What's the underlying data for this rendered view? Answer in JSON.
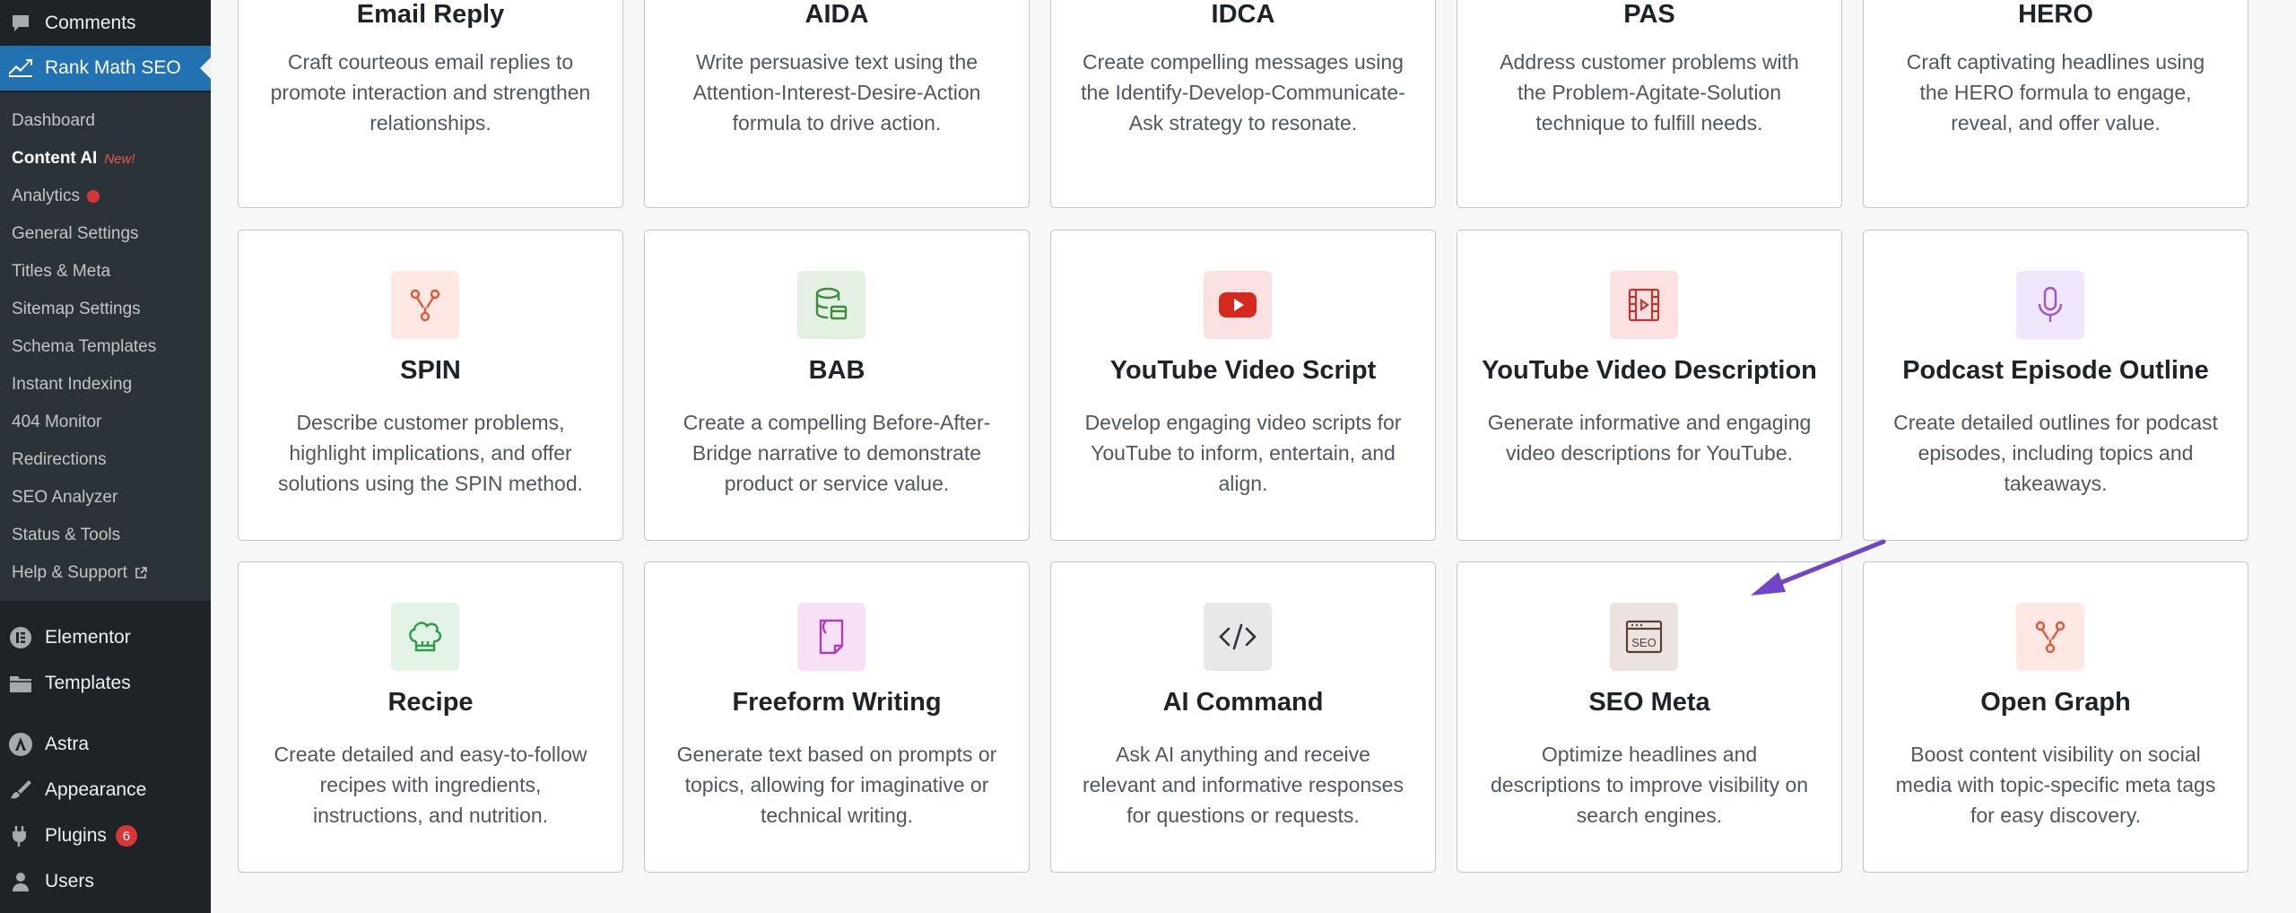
{
  "sidebar": {
    "comments": "Comments",
    "rankmath": "Rank Math SEO",
    "submenu": [
      {
        "label": "Dashboard"
      },
      {
        "label": "Content AI",
        "tag": "New!"
      },
      {
        "label": "Analytics"
      },
      {
        "label": "General Settings"
      },
      {
        "label": "Titles & Meta"
      },
      {
        "label": "Sitemap Settings"
      },
      {
        "label": "Schema Templates"
      },
      {
        "label": "Instant Indexing"
      },
      {
        "label": "404 Monitor"
      },
      {
        "label": "Redirections"
      },
      {
        "label": "SEO Analyzer"
      },
      {
        "label": "Status & Tools"
      },
      {
        "label": "Help & Support"
      }
    ],
    "elementor": "Elementor",
    "templates": "Templates",
    "astra": "Astra",
    "appearance": "Appearance",
    "plugins": "Plugins",
    "plugins_badge": "6",
    "users": "Users"
  },
  "cards": [
    {
      "title": "Email Reply",
      "desc": "Craft courteous email replies to promote interaction and strengthen relationships."
    },
    {
      "title": "AIDA",
      "desc": "Write persuasive text using the Attention-Interest-Desire-Action formula to drive action."
    },
    {
      "title": "IDCA",
      "desc": "Create compelling messages using the Identify-Develop-Communicate-Ask strategy to resonate."
    },
    {
      "title": "PAS",
      "desc": "Address customer problems with the Problem-Agitate-Solution technique to fulfill needs."
    },
    {
      "title": "HERO",
      "desc": "Craft captivating headlines using the HERO formula to engage, reveal, and offer value."
    },
    {
      "title": "SPIN",
      "desc": "Describe customer problems, highlight implications, and offer solutions using the SPIN method.",
      "icon": "branch-icon"
    },
    {
      "title": "BAB",
      "desc": "Create a compelling Before-After-Bridge narrative to demonstrate product or service value.",
      "icon": "database-icon"
    },
    {
      "title": "YouTube Video Script",
      "desc": "Develop engaging video scripts for YouTube to inform, entertain, and align.",
      "icon": "youtube-icon"
    },
    {
      "title": "YouTube Video Description",
      "desc": "Generate informative and engaging video descriptions for YouTube.",
      "icon": "film-icon"
    },
    {
      "title": "Podcast Episode Outline",
      "desc": "Create detailed outlines for podcast episodes, including topics and takeaways.",
      "icon": "microphone-icon"
    },
    {
      "title": "Recipe",
      "desc": "Create detailed and easy-to-follow recipes with ingredients, instructions, and nutrition.",
      "icon": "chef-hat-icon"
    },
    {
      "title": "Freeform Writing",
      "desc": "Generate text based on prompts or topics, allowing for imaginative or technical writing.",
      "icon": "document-icon"
    },
    {
      "title": "AI Command",
      "desc": "Ask AI anything and receive relevant and informative responses for questions or requests.",
      "icon": "code-icon"
    },
    {
      "title": "SEO Meta",
      "desc": "Optimize headlines and descriptions to improve visibility on search engines.",
      "icon": "seo-icon",
      "icon_text": "SEO"
    },
    {
      "title": "Open Graph",
      "desc": "Boost content visibility on social media with topic-specific meta tags for easy discovery.",
      "icon": "branch-icon"
    }
  ],
  "colors": {
    "sidebar_bg": "#1d2327",
    "submenu_bg": "#2c3338",
    "accent": "#2271b1",
    "arrow": "#7145c7",
    "badge": "#d63638"
  }
}
